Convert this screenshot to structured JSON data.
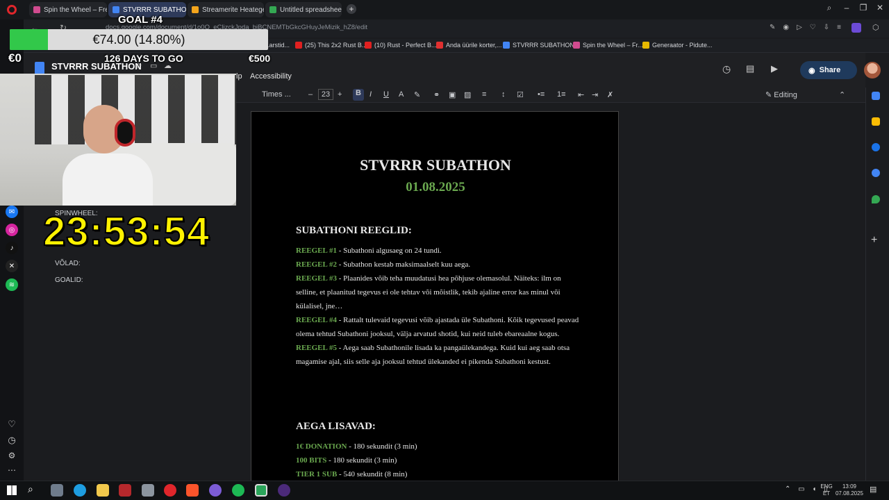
{
  "browser": {
    "tabs": [
      {
        "label": "Spin the Wheel – Free and",
        "color": "#d14b8f",
        "active": false
      },
      {
        "label": "STVRRR SUBATHON - Go",
        "color": "#4285f4",
        "active": true
      },
      {
        "label": "Streamerite Heategevusm",
        "color": "#f4a51c",
        "active": false
      },
      {
        "label": "Untitled spreadsheet - Go",
        "color": "#34a853",
        "active": false
      }
    ],
    "url": "docs.google.com/document/d/1o0Q_eCljzckJpda_bjBCNEMTbGkcGHuyJeMizik_hZ8/edit",
    "bookmarks": [
      {
        "label": "...arstid...",
        "color": "#cc2222"
      },
      {
        "label": "(25) This 2x2 Rust B...",
        "color": "#e02020"
      },
      {
        "label": "(10) Rust - Perfect B...",
        "color": "#e02020"
      },
      {
        "label": "Anda üürile korter,...",
        "color": "#e03030"
      },
      {
        "label": "STVRRR SUBATHON...",
        "color": "#4285f4"
      },
      {
        "label": "Spin the Wheel – Fr...",
        "color": "#d14b8f"
      },
      {
        "label": "Generaator - Pidute...",
        "color": "#e6b800"
      }
    ]
  },
  "docs": {
    "doc_name": "STVRRR SUBATHON",
    "menu_partial": "lp",
    "menu_accessibility": "Accessibility",
    "font_name": "Times ...",
    "font_size": "23",
    "mode": "Editing",
    "share_label": "Share"
  },
  "document": {
    "title": "STVRRR SUBATHON",
    "date": "01.08.2025",
    "rules_heading": "SUBATHONI REEGLID:",
    "rules": [
      {
        "tag": "REEGEL #1",
        "text": " - Subathoni algusaeg on 24 tundi."
      },
      {
        "tag": "REEGEL #2",
        "text": " - Subathon kestab maksimaalselt kuu aega."
      },
      {
        "tag": "REEGEL #3",
        "text": " - Plaanides võib teha muudatusi hea põhjuse olemasolul. Näiteks: ilm on selline, et plaanitud tegevus ei ole tehtav või mõistlik, tekib ajaline error kas minul või külalisel, jne…"
      },
      {
        "tag": "REEGEL #4",
        "text": " - Rattalt tulevaid tegevusi võib ajastada üle Subathoni. Kõik tegevused peavad olema tehtud Subathoni jooksul, välja arvatud shotid, kui neid tuleb ebareaalne kogus."
      },
      {
        "tag": "REEGEL #5",
        "text": " - Aega saab Subathonile lisada ka pangaülekandega. Kuid kui aeg saab otsa magamise ajal, siis selle aja jooksul tehtud ülekanded ei pikenda Subathoni kestust."
      }
    ],
    "time_heading": "AEGA LISAVAD:",
    "time_items": [
      {
        "tag": "1€ DONATION",
        "text": " - 180 sekundit (3 min)"
      },
      {
        "tag": "100 BITS",
        "text": " - 180 sekundit (3 min)"
      },
      {
        "tag": "TIER 1 SUB",
        "text": " - 540 sekundit (8 min)"
      }
    ]
  },
  "overlay": {
    "goal_label": "GOAL #4",
    "goal_progress_text": "€74.00 (14.80%)",
    "goal_progress": 0.148,
    "goal_min": "€0",
    "goal_max": "€500",
    "days_to_go": "126 DAYS TO GO",
    "timer": "23:53:54"
  },
  "left_panel": {
    "items": [
      "SPINWHEEL:",
      "VÕLAD:",
      "GOALID:"
    ]
  },
  "taskbar": {
    "lang": "ENG",
    "lang2": "ET",
    "time": "13:09",
    "date": "07.08.2025"
  }
}
